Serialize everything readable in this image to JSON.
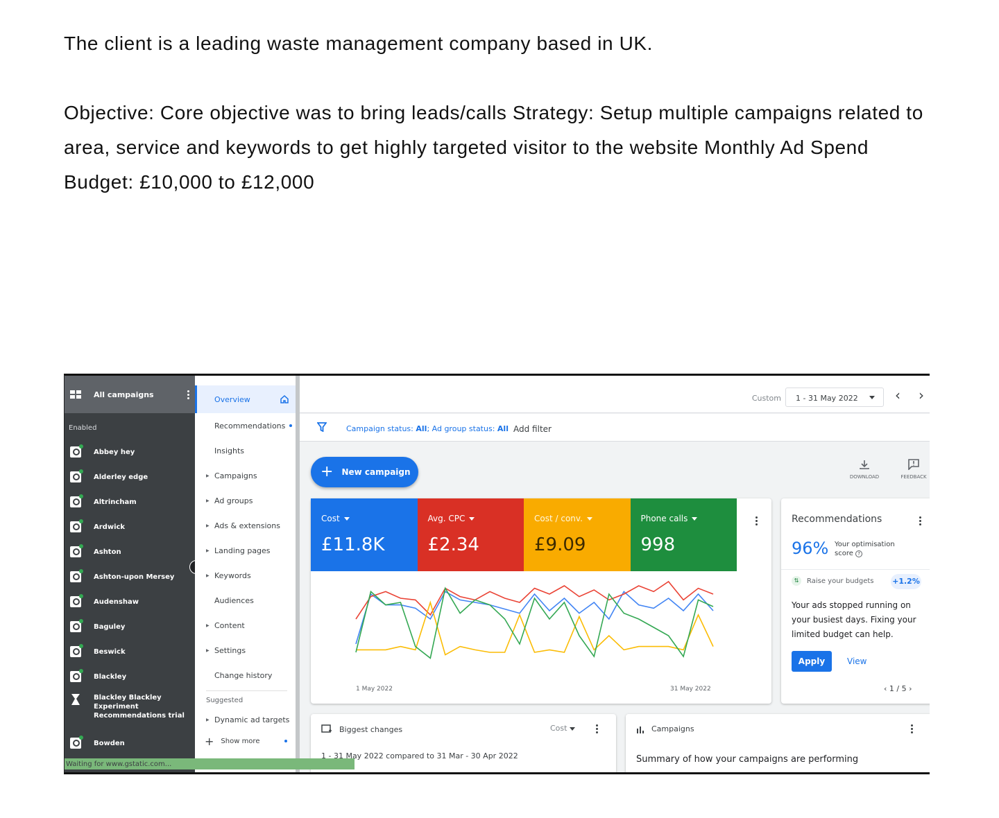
{
  "intro": {
    "line1": "The client is a leading waste management company based in UK.",
    "line2": "Objective: Core objective was to bring leads/calls Strategy: Setup multiple campaigns related to area, service and keywords to get highly targeted visitor to the website Monthly Ad Spend Budget: £10,000 to £12,000"
  },
  "sidebar": {
    "title": "All campaigns",
    "section": "Enabled",
    "items": [
      {
        "label": "Abbey hey"
      },
      {
        "label": "Alderley edge"
      },
      {
        "label": "Altrincham"
      },
      {
        "label": "Ardwick"
      },
      {
        "label": "Ashton"
      },
      {
        "label": "Ashton-upon Mersey"
      },
      {
        "label": "Audenshaw"
      },
      {
        "label": "Baguley"
      },
      {
        "label": "Beswick"
      },
      {
        "label": "Blackley"
      }
    ],
    "experiment_label": "Blackley Blackley Experiment Recommendations trial",
    "last_item": "Bowden"
  },
  "nav": {
    "overview": "Overview",
    "items": [
      "Recommendations",
      "Insights",
      "Campaigns",
      "Ad groups",
      "Ads & extensions",
      "Landing pages",
      "Keywords",
      "Audiences",
      "Content",
      "Settings",
      "Change history"
    ],
    "suggested": "Suggested",
    "dynamic": "Dynamic ad targets",
    "show_more": "Show more"
  },
  "topbar": {
    "custom": "Custom",
    "date_range": "1 - 31 May 2022",
    "prev": "‹",
    "next": "›"
  },
  "filter": {
    "text_prefix": "Campaign status: ",
    "text_all1": "All",
    "text_mid": "; Ad group status: ",
    "text_all2": "All",
    "add_filter": "Add filter"
  },
  "toolbar": {
    "new_campaign": "New campaign",
    "download": "DOWNLOAD",
    "feedback": "FEEDBACK"
  },
  "kpis": [
    {
      "label": "Cost",
      "value": "£11.8K",
      "color": "#1a73e8"
    },
    {
      "label": "Avg. CPC",
      "value": "£2.34",
      "color": "#d93025"
    },
    {
      "label": "Cost / conv.",
      "value": "£9.09",
      "color": "#f9ab00"
    },
    {
      "label": "Phone calls",
      "value": "998",
      "color": "#1e8e3e"
    }
  ],
  "chart_data": {
    "type": "line",
    "x_start": "1 May 2022",
    "x_end": "31 May 2022",
    "series": [
      {
        "name": "Cost",
        "color": "#4285f4",
        "values": [
          0.25,
          0.85,
          0.72,
          0.72,
          0.68,
          0.55,
          0.88,
          0.78,
          0.75,
          0.72,
          0.67,
          0.62,
          0.85,
          0.65,
          0.8,
          0.62,
          0.75,
          0.55,
          0.88,
          0.72,
          0.68,
          0.8,
          0.65,
          0.85,
          0.65
        ]
      },
      {
        "name": "Avg. CPC",
        "color": "#ea4335",
        "values": [
          0.55,
          0.82,
          0.88,
          0.8,
          0.78,
          0.6,
          0.92,
          0.82,
          0.78,
          0.88,
          0.8,
          0.75,
          0.92,
          0.85,
          0.95,
          0.82,
          0.9,
          0.78,
          0.85,
          0.95,
          0.88,
          1.0,
          0.78,
          0.92,
          0.85
        ]
      },
      {
        "name": "Cost / conv.",
        "color": "#fbbc04",
        "values": [
          0.18,
          0.18,
          0.18,
          0.22,
          0.18,
          0.75,
          0.12,
          0.22,
          0.18,
          0.15,
          0.15,
          0.6,
          0.15,
          0.18,
          0.15,
          0.58,
          0.18,
          0.35,
          0.18,
          0.22,
          0.22,
          0.22,
          0.18,
          0.6,
          0.22
        ]
      },
      {
        "name": "Phone calls",
        "color": "#34a853",
        "values": [
          0.15,
          0.88,
          0.72,
          0.75,
          0.22,
          0.08,
          0.92,
          0.62,
          0.78,
          0.72,
          0.55,
          0.25,
          0.8,
          0.55,
          0.75,
          0.35,
          0.1,
          0.85,
          0.62,
          0.55,
          0.45,
          0.35,
          0.1,
          0.78,
          0.7
        ]
      }
    ]
  },
  "recommendations": {
    "title": "Recommendations",
    "score": "96%",
    "score_label": "Your optimisation score",
    "tip": "Raise your budgets",
    "lift": "+1.2%",
    "body": "Your ads stopped running on your busiest days. Fixing your limited budget can help.",
    "apply": "Apply",
    "view": "View",
    "pager": "1 / 5"
  },
  "biggest_changes": {
    "title": "Biggest changes",
    "metric": "Cost",
    "sub": "1 - 31 May 2022 compared to 31 Mar - 30 Apr 2022"
  },
  "campaigns_card": {
    "title": "Campaigns",
    "summary": "Summary of how your campaigns are performing"
  },
  "status_bar": "Waiting for www.gstatic.com..."
}
